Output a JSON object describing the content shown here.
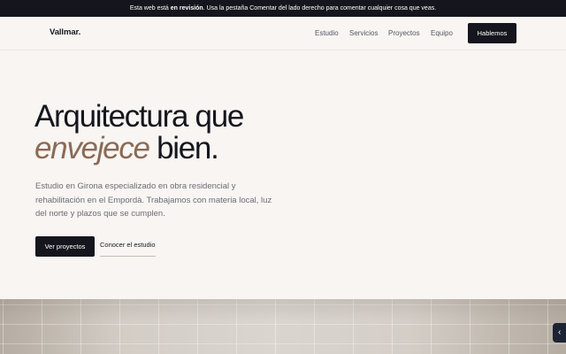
{
  "banner": {
    "prefix": "Esta web está ",
    "bold": "en revisión",
    "suffix": ". Usa la pestaña Comentar del lado derecho para comentar cualquier cosa que veas."
  },
  "header": {
    "logo": "Vallmar.",
    "nav": [
      "Estudio",
      "Servicios",
      "Proyectos",
      "Equipo"
    ],
    "cta": "Hablemos"
  },
  "hero": {
    "title_line1": "Arquitectura que",
    "title_accent": "envejece",
    "title_rest": " bien.",
    "description": "Estudio en Girona especializado en obra residencial y rehabilitación en el Empordà. Trabajamos con materia local, luz del norte y plazos que se cumplen.",
    "primary_button": "Ver proyectos",
    "secondary_button": "Conocer el estudio"
  },
  "comment_tab": {
    "icon": "chevron-left-icon",
    "glyph": "‹"
  },
  "colors": {
    "dark": "#15161d",
    "accent": "#8a6b55",
    "background": "#f8f5f3"
  }
}
